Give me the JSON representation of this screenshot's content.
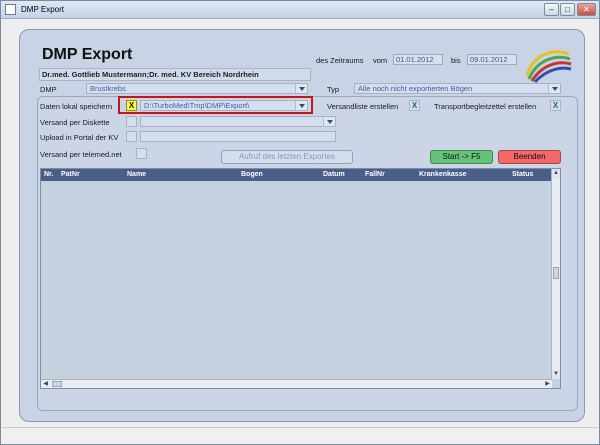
{
  "window": {
    "title": "DMP Export"
  },
  "header": {
    "app_title": "DMP Export",
    "doctor": "Dr.med. Gottlieb Mustermann;Dr. med. KV Bereich Nordrhein",
    "period_label": "des Zeitraums",
    "from_label": "vom",
    "from_date": "01.01.2012",
    "to_label": "bis",
    "to_date": "09.01.2012"
  },
  "form": {
    "dmp_label": "DMP",
    "dmp_value": "Brustkrebs",
    "typ_label": "Typ",
    "typ_value": "Alle noch nicht exportierten Bögen",
    "save_local_label": "Daten lokal speichern",
    "save_local_check": "X",
    "save_local_path": "D:\\TurboMed\\Tmp\\DMP\\Export\\",
    "versandliste_label": "Versandliste erstellen",
    "versandliste_check": "X",
    "transport_label": "Transportbegleitzettel erstellen",
    "transport_check": "X",
    "diskette_label": "Versand per Diskette",
    "upload_label": "Upload in Portal der KV",
    "telemed_label": "Versand per telemed.net"
  },
  "buttons": {
    "last_export": "Aufruf des letzten Exportes",
    "start": "Start -> F5",
    "end": "Beenden"
  },
  "table": {
    "columns": [
      "Nr.",
      "PatNr",
      "Name",
      "Bogen",
      "Datum",
      "FallNr",
      "Krankenkasse",
      "Status"
    ]
  }
}
